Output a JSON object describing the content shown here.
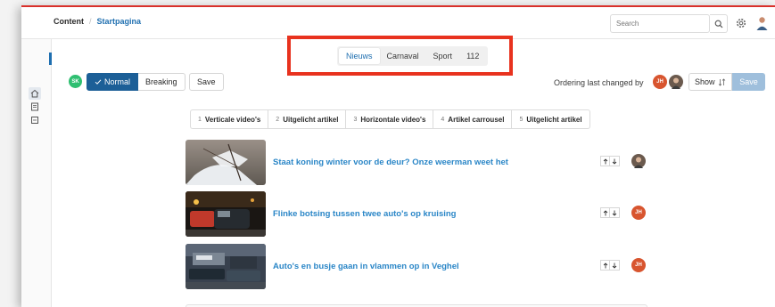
{
  "breadcrumb": {
    "root": "Content",
    "separator": "/",
    "current": "Startpagina"
  },
  "header": {
    "search": {
      "placeholder": "Search",
      "value": ""
    },
    "search_icon": "search-icon",
    "settings_icon": "gear-icon",
    "user_avatar": "user-avatar"
  },
  "sidebar": {
    "items": [
      {
        "icon": "home-icon"
      },
      {
        "icon": "news-icon"
      },
      {
        "icon": "media-icon"
      }
    ]
  },
  "tabs": [
    {
      "label": "Nieuws",
      "active": true
    },
    {
      "label": "Carnaval"
    },
    {
      "label": "Sport"
    },
    {
      "label": "112"
    }
  ],
  "toolbar": {
    "user_badge": "SK",
    "modes": [
      {
        "label": "Normal",
        "active": true
      },
      {
        "label": "Breaking"
      }
    ],
    "save_label": "Save",
    "ordering_text": "Ordering last changed by",
    "ordering_avatars": [
      "JH",
      ""
    ],
    "show_label": "Show",
    "save_right_label": "Save"
  },
  "sections": [
    {
      "num": "1",
      "label": "Verticale video's"
    },
    {
      "num": "2",
      "label": "Uitgelicht artikel"
    },
    {
      "num": "3",
      "label": "Horizontale video's"
    },
    {
      "num": "4",
      "label": "Artikel carrousel"
    },
    {
      "num": "5",
      "label": "Uitgelicht artikel"
    }
  ],
  "articles": [
    {
      "title": "Staat koning winter voor de deur? Onze weerman weet het",
      "author": ""
    },
    {
      "title": "Flinke botsing tussen twee auto's op kruising",
      "author": "JH"
    },
    {
      "title": "Auto's en busje gaan in vlammen op in Veghel",
      "author": "JH"
    }
  ],
  "colors": {
    "accent": "#1f6fb0",
    "link": "#2a86c7",
    "highlight": "#e8321e",
    "badge_green": "#2fbf71",
    "avatar_orange": "#d8552f"
  }
}
